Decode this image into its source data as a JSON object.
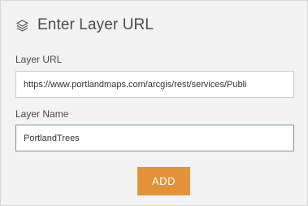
{
  "header": {
    "icon": "layers-icon",
    "title": "Enter Layer URL"
  },
  "form": {
    "url_label": "Layer URL",
    "url_value": "https://www.portlandmaps.com/arcgis/rest/services/Publi",
    "name_label": "Layer Name",
    "name_value": "PortlandTrees"
  },
  "actions": {
    "add_label": "ADD"
  },
  "colors": {
    "panel_background": "#f3f3f3",
    "accent": "#e4923a",
    "text": "#4a4a4a",
    "focused_border": "#7a8ea8"
  }
}
